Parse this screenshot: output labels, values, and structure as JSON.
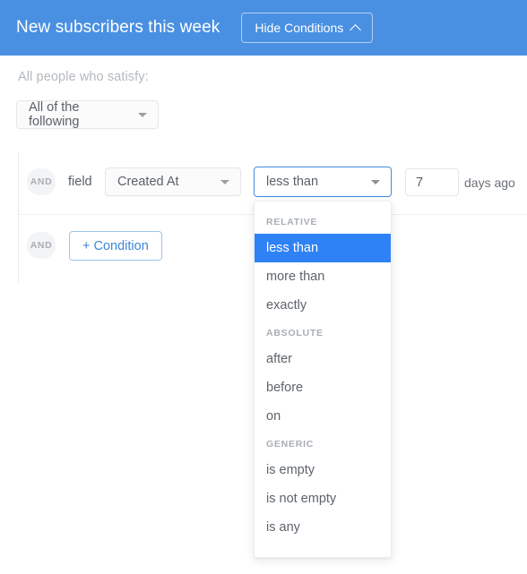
{
  "header": {
    "title": "New subscribers this week",
    "hide_conditions_label": "Hide Conditions",
    "chevron_icon": "chevron-up-icon",
    "background_color": "#4a90e2"
  },
  "conditions_panel": {
    "satisfy_label": "All people who satisfy:",
    "match_select": {
      "value": "All of the following",
      "caret_icon": "caret-down-icon"
    },
    "rows": [
      {
        "connector": "AND",
        "field_label": "field",
        "field_select": {
          "value": "Created At",
          "caret_icon": "caret-down-icon"
        },
        "operator_select": {
          "value": "less than",
          "caret_icon": "caret-down-icon",
          "focused": true,
          "focus_color": "#4a90e2"
        },
        "value_input": {
          "value": "7",
          "placeholder": ""
        },
        "units_label": "days ago"
      },
      {
        "connector": "AND",
        "add_condition_label": "+ Condition",
        "add_condition_color": "#3b86d8"
      }
    ]
  },
  "operator_dropdown": {
    "selected_value": "less than",
    "highlight_color": "#2f82f5",
    "groups": [
      {
        "label": "RELATIVE",
        "items": [
          {
            "label": "less than",
            "selected": true
          },
          {
            "label": "more than",
            "selected": false
          },
          {
            "label": "exactly",
            "selected": false
          }
        ]
      },
      {
        "label": "ABSOLUTE",
        "items": [
          {
            "label": "after",
            "selected": false
          },
          {
            "label": "before",
            "selected": false
          },
          {
            "label": "on",
            "selected": false
          }
        ]
      },
      {
        "label": "GENERIC",
        "items": [
          {
            "label": "is empty",
            "selected": false
          },
          {
            "label": "is not empty",
            "selected": false
          },
          {
            "label": "is any",
            "selected": false
          }
        ]
      }
    ]
  }
}
